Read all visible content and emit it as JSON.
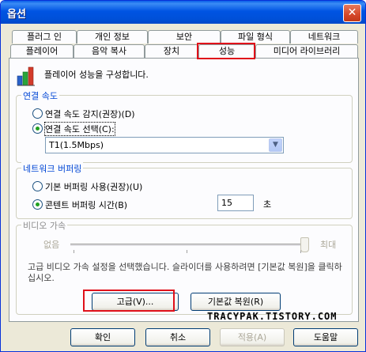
{
  "window": {
    "title": "옵션",
    "close_glyph": "✕"
  },
  "tabs_row1": [
    "플러그 인",
    "개인 정보",
    "보안",
    "파일 형식",
    "네트워크"
  ],
  "tabs_row2": [
    "플레이어",
    "음악 복사",
    "장치",
    "성능",
    "미디어 라이브러리"
  ],
  "active_tab": "성능",
  "description": "플레이어 성능을 구성합니다.",
  "connection": {
    "legend": "연결 속도",
    "option_detect": "연결 속도 감지(권장)(D)",
    "option_choose": "연결 속도 선택(C):",
    "selected": "option_choose",
    "speed_value": "T1(1.5Mbps)"
  },
  "buffering": {
    "legend": "네트워크 버퍼링",
    "option_default": "기본 버퍼링 사용(권장)(U)",
    "option_content": "콘텐트 버퍼링 시간(B)",
    "selected": "option_content",
    "seconds_value": "15",
    "seconds_unit": "초"
  },
  "video": {
    "legend": "비디오 가속",
    "min_label": "없음",
    "max_label": "최대",
    "slider_level": 1.0,
    "note": "고급 비디오 가속 설정을 선택했습니다. 슬라이더를 사용하려면 [기본값 복원]을 클릭하십시오.",
    "advanced_button": "고급(V)...",
    "restore_button": "기본값 복원(R)"
  },
  "watermark": "TRACYPAK.TISTORY.COM",
  "footer": {
    "ok": "확인",
    "cancel": "취소",
    "apply": "적용(A)",
    "help": "도움말"
  },
  "colors": {
    "highlight": "#e0101a",
    "titlebar": "#0054e3",
    "legend_text": "#0046d5"
  }
}
